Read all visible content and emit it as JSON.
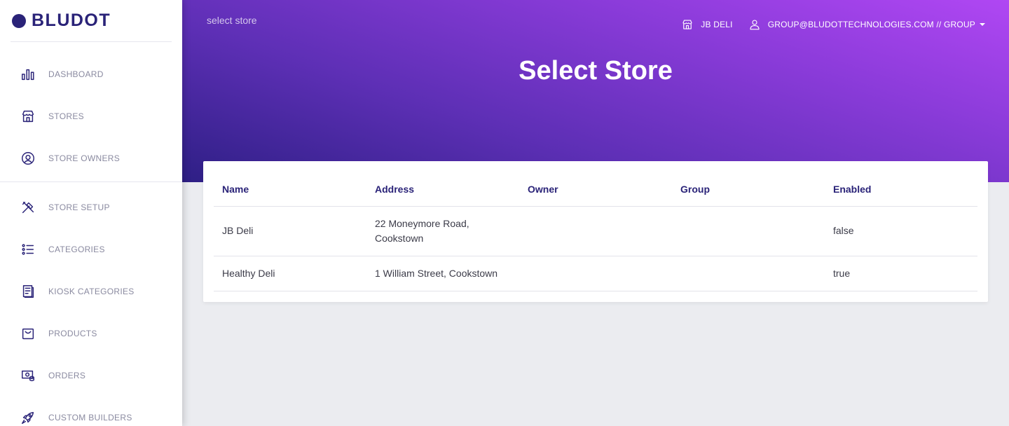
{
  "brand": {
    "name": "BLUDOT"
  },
  "sidebar": {
    "group1": [
      {
        "label": "DASHBOARD",
        "icon": "bar-chart-icon"
      },
      {
        "label": "STORES",
        "icon": "store-icon"
      },
      {
        "label": "STORE OWNERS",
        "icon": "owner-icon"
      }
    ],
    "group2": [
      {
        "label": "STORE SETUP",
        "icon": "tools-icon"
      },
      {
        "label": "CATEGORIES",
        "icon": "list-icon"
      },
      {
        "label": "KIOSK CATEGORIES",
        "icon": "document-icon"
      },
      {
        "label": "PRODUCTS",
        "icon": "bag-icon"
      },
      {
        "label": "ORDERS",
        "icon": "money-icon"
      },
      {
        "label": "CUSTOM BUILDERS",
        "icon": "rocket-icon"
      }
    ]
  },
  "header": {
    "breadcrumb": "select store",
    "store_name": "JB DELI",
    "user": "GROUP@BLUDOTTECHNOLOGIES.COM // GROUP",
    "title": "Select Store"
  },
  "table": {
    "columns": [
      "Name",
      "Address",
      "Owner",
      "Group",
      "Enabled"
    ],
    "rows": [
      {
        "name": "JB Deli",
        "address": "22 Moneymore Road, Cookstown",
        "owner": "",
        "group": "",
        "enabled": "false"
      },
      {
        "name": "Healthy Deli",
        "address": "1 William Street, Cookstown",
        "owner": "",
        "group": "",
        "enabled": "true"
      }
    ]
  },
  "colors": {
    "brand": "#2a2378",
    "gradient_start": "#2e1f85",
    "gradient_end": "#b047f3",
    "background": "#ebecf0"
  }
}
